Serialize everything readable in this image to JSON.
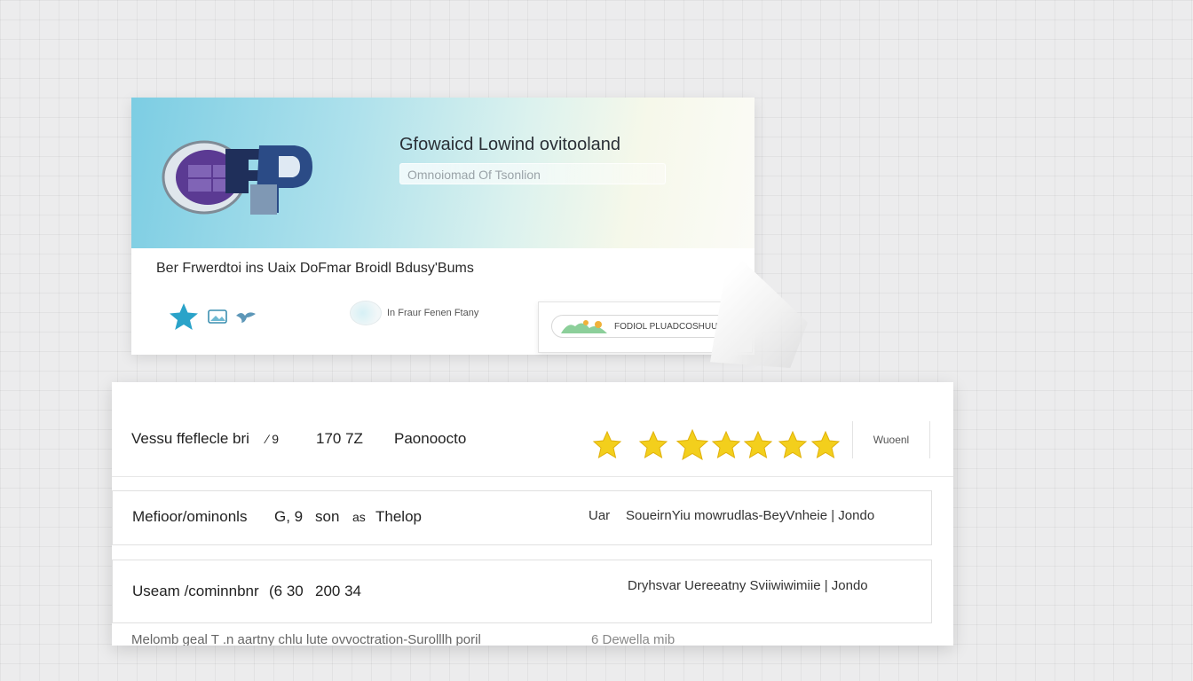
{
  "banner": {
    "title": "Gfowaicd Lowind ovitooland",
    "field_text": "Omnoiomad Of Tsonlion"
  },
  "subheading": "Ber Frwerdtoi ins Uaix DoFmar Broidl Bdusy'Bums",
  "preview_tag": {
    "label": "In Fraur Fenen Ftany"
  },
  "callout": {
    "label": "FODIOL PLUADCOSHUUP"
  },
  "rows": [
    {
      "c1": "Vessu ffeflecle bri",
      "c2": "∕ 9",
      "c3": "170 7Z",
      "c4": "Paonoocto",
      "rating": 7,
      "rating_label": "Wuoenl"
    },
    {
      "c1": "Mefioor/ominonls",
      "c2": "G, 9",
      "c3": "son",
      "c4": "Thelop",
      "right_prefix": "Uar",
      "right_text": "SoueirnYiu mowrudlas-BeyVnheie | Jondo"
    },
    {
      "c1": "Useam /cominnbnr",
      "c2": "(6 30",
      "c3": "200 34",
      "right_text": "Dryhsvar Uereeatny Sviiwiwimiie | Jondo"
    },
    {
      "c1": "Melomb geal T .n aartny chlu lute ovvoctration-Surolllh poril",
      "c2": "6 Dewella mib"
    }
  ],
  "colors": {
    "star": "#f3cf1c",
    "accent_blue": "#2aa3c9",
    "logo_purple": "#5b3a93",
    "logo_navy": "#1f2f5a"
  }
}
